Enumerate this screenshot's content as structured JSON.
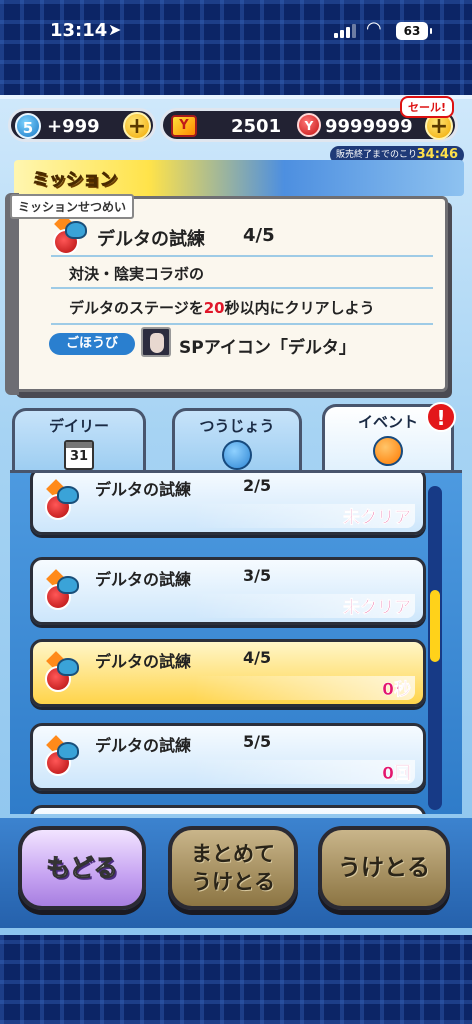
{
  "status_bar": {
    "time": "13:14",
    "battery": "63"
  },
  "currency": {
    "orb_count": "5",
    "orb_extra": "+999",
    "tickets": "2501",
    "coins": "9999999",
    "sale_label": "セール!",
    "sale_timer_label": "販売終了までのこり",
    "sale_timer": "34:46"
  },
  "mission": {
    "header": "ミッション",
    "desc_label": "ミッションせつめい",
    "title": "デルタの試練",
    "progress": "4/5",
    "line1": "対決・陰実コラボの",
    "line2_pre": "デルタのステージを",
    "line2_num": "20",
    "line2_post": "秒以内にクリアしよう",
    "reward_tag": "ごほうび",
    "reward": "SPアイコン「デルタ」"
  },
  "tabs": [
    {
      "label": "デイリー",
      "icon": "calendar-icon",
      "icon_text": "31"
    },
    {
      "label": "つうじょう",
      "icon": "check-bubble-icon"
    },
    {
      "label": "イベント",
      "icon": "event-bubble-icon",
      "alert": "!"
    }
  ],
  "missions": [
    {
      "title": "デルタの試練",
      "progress": "2/5",
      "status": "未クリア"
    },
    {
      "title": "デルタの試練",
      "progress": "3/5",
      "status": "未クリア"
    },
    {
      "title": "デルタの試練",
      "progress": "4/5",
      "status": "0秒"
    },
    {
      "title": "デルタの試練",
      "progress": "5/5",
      "status": "0回"
    }
  ],
  "buttons": {
    "back": "もどる",
    "bulk_line1": "まとめて",
    "bulk_line2": "うけとる",
    "receive": "うけとる"
  },
  "colors": {
    "accent_gold": "#ffd44a",
    "status_pink": "#e2166e",
    "alert_red": "#e3171a"
  }
}
